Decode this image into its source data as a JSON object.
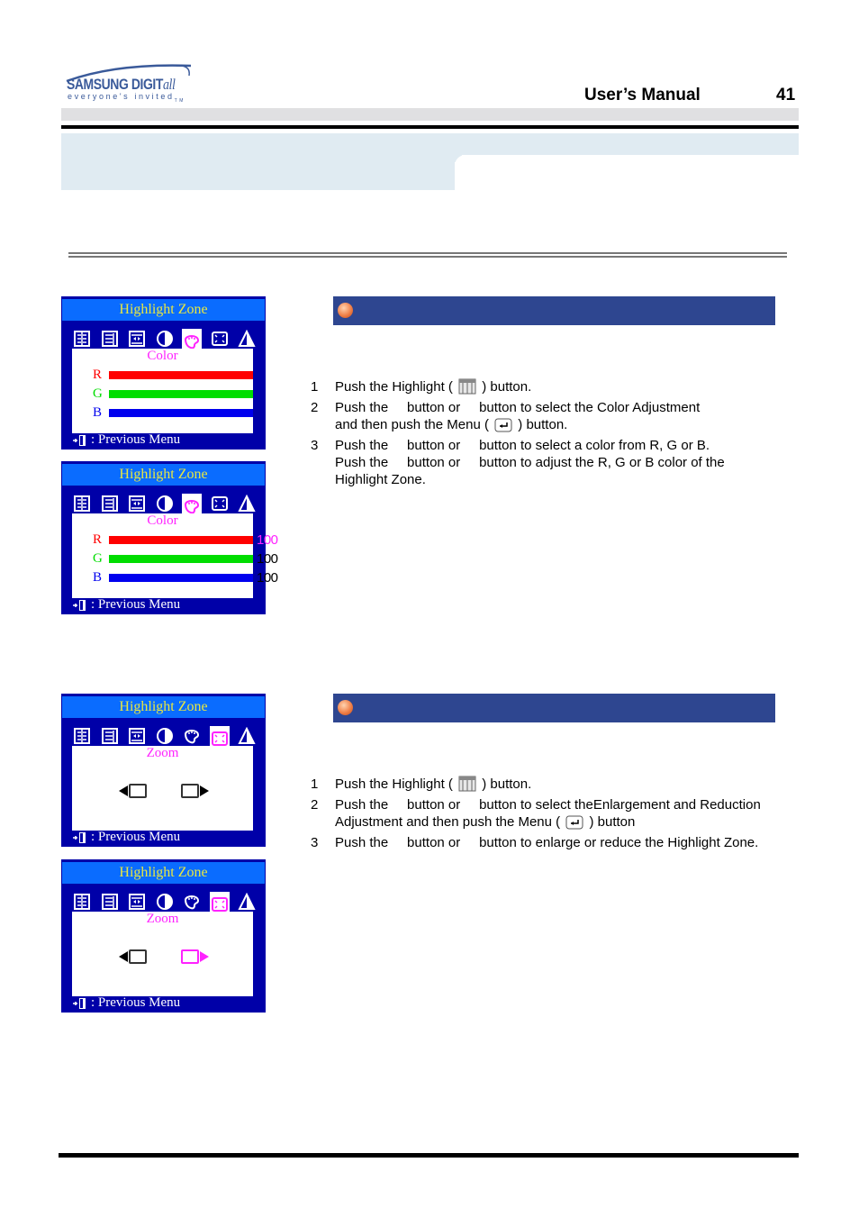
{
  "header": {
    "logo": {
      "brand": "SAMSUNG DIGIT",
      "brand_suffix": "all",
      "tagline": "everyone's invited",
      "tm": "TM"
    },
    "title": "User’s Manual",
    "page_number": "41"
  },
  "osd_panels": [
    {
      "title": "Highlight Zone",
      "icons": [
        "contrast-box-icon",
        "sharpness-box-icon",
        "brightness-box-icon",
        "half-circle-icon",
        "color-palette-icon",
        "zoom-box-icon",
        "triangle-icon"
      ],
      "active_icon": "color-palette-icon",
      "panel_title": "Color",
      "rows": [
        {
          "letter": "R",
          "color": "#ff0000",
          "value": null
        },
        {
          "letter": "G",
          "color": "#00dd00",
          "value": null
        },
        {
          "letter": "B",
          "color": "#0000ee",
          "value": null
        }
      ],
      "footer": ": Previous Menu"
    },
    {
      "title": "Highlight Zone",
      "active_icon": "color-palette-icon",
      "panel_title": "Color",
      "rows": [
        {
          "letter": "R",
          "color": "#ff0000",
          "value": "100",
          "value_color": "#ff22ff"
        },
        {
          "letter": "G",
          "color": "#00dd00",
          "value": "100",
          "value_color": "#000000"
        },
        {
          "letter": "B",
          "color": "#0000ee",
          "value": "100",
          "value_color": "#000000"
        }
      ],
      "footer": ": Previous Menu"
    },
    {
      "title": "Highlight Zone",
      "active_icon": "zoom-box-icon",
      "panel_title": "Zoom",
      "zoom_selected": "none",
      "footer": ": Previous Menu"
    },
    {
      "title": "Highlight Zone",
      "active_icon": "zoom-box-icon",
      "panel_title": "Zoom",
      "zoom_selected": "enlarge",
      "footer": ": Previous Menu"
    }
  ],
  "sections": [
    {
      "steps": [
        {
          "num": "1",
          "lines": [
            "Push the Highlight ( [highlight-icon] ) button."
          ]
        },
        {
          "num": "2",
          "lines": [
            "Push the     button or     button to select the Color Adjustment",
            "and then push the Menu ( [menu-icon] ) button."
          ]
        },
        {
          "num": "3",
          "lines": [
            "Push the     button or     button to select a color from R, G or B.",
            "Push the     button or     button to adjust the R, G or B color of the",
            "Highlight Zone."
          ]
        }
      ]
    },
    {
      "steps": [
        {
          "num": "1",
          "lines": [
            "Push the Highlight ( [highlight-icon] ) button."
          ]
        },
        {
          "num": "2",
          "lines": [
            "Push the     button or     button to select theEnlargement and Reduction",
            "Adjustment and then push the Menu ( [menu-icon] ) button"
          ]
        },
        {
          "num": "3",
          "lines": [
            "Push the     button or     button to enlarge or reduce the Highlight Zone."
          ]
        }
      ]
    }
  ],
  "colors": {
    "osd_background": "#0000a8",
    "osd_titlebar": "#0a6cff",
    "osd_title_text": "#e8e840",
    "osd_accent": "#ff22ff",
    "section_bar": "#2e4690",
    "banner": "#e0ebf2"
  }
}
